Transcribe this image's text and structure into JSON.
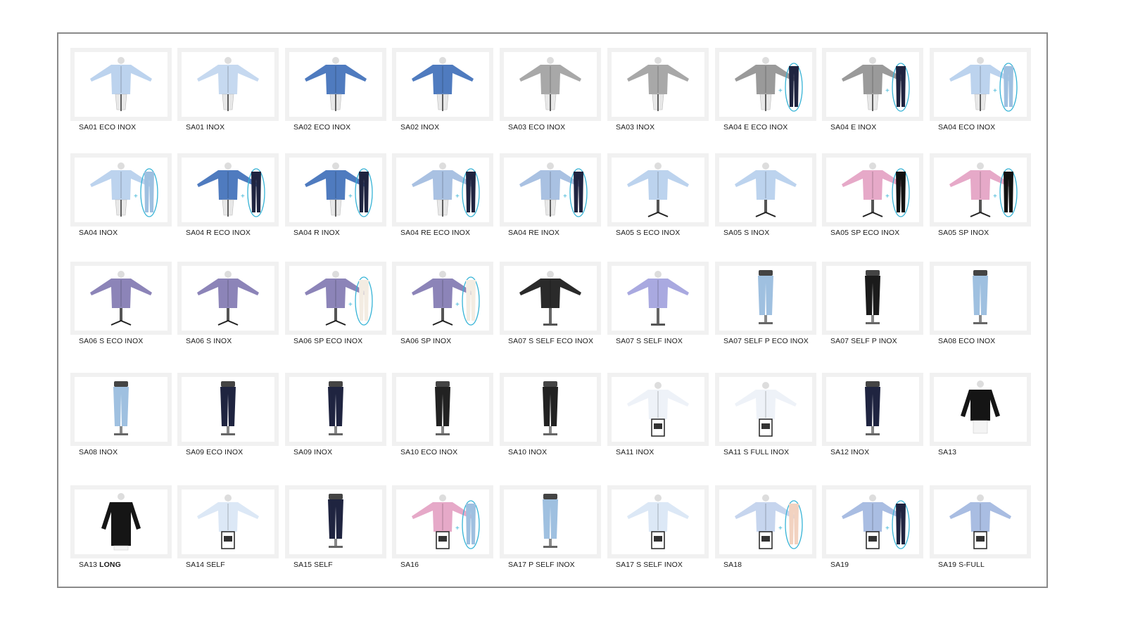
{
  "products": [
    {
      "label": "SA01 ECO INOX",
      "shirt": "#bcd3ee",
      "stand": "dress",
      "extra": null
    },
    {
      "label": "SA01 INOX",
      "shirt": "#c6d9f0",
      "stand": "dress",
      "extra": null
    },
    {
      "label": "SA02 ECO INOX",
      "shirt": "#4f7bbf",
      "stand": "dress",
      "extra": null
    },
    {
      "label": "SA02 INOX",
      "shirt": "#4f7bbf",
      "stand": "dress",
      "extra": null
    },
    {
      "label": "SA03 ECO INOX",
      "shirt": "#a8a8a8",
      "stand": "dress",
      "extra": null
    },
    {
      "label": "SA03 INOX",
      "shirt": "#a8a8a8",
      "stand": "dress",
      "extra": null
    },
    {
      "label": "SA04 E ECO INOX",
      "shirt": "#9a9a9a",
      "stand": "dress",
      "extra": "#1f2440"
    },
    {
      "label": "SA04 E INOX",
      "shirt": "#9a9a9a",
      "stand": "dress",
      "extra": "#1f2440"
    },
    {
      "label": "SA04 ECO INOX",
      "shirt": "#bcd3ee",
      "stand": "dress",
      "extra": "#9fc0e0"
    },
    {
      "label": "SA04 INOX",
      "shirt": "#bcd3ee",
      "stand": "dress",
      "extra": "#9fc0e0"
    },
    {
      "label": "SA04 R ECO INOX",
      "shirt": "#4f7bbf",
      "stand": "dress",
      "extra": "#1f2440"
    },
    {
      "label": "SA04 R INOX",
      "shirt": "#4f7bbf",
      "stand": "dress",
      "extra": "#1f2440"
    },
    {
      "label": "SA04 RE ECO INOX",
      "shirt": "#a9c1e2",
      "stand": "dress",
      "extra": "#1f2440"
    },
    {
      "label": "SA04 RE INOX",
      "shirt": "#a9c1e2",
      "stand": "dress",
      "extra": "#1f2440"
    },
    {
      "label": "SA05 S ECO INOX",
      "shirt": "#bcd3ee",
      "stand": "chair",
      "extra": null
    },
    {
      "label": "SA05 S INOX",
      "shirt": "#bcd3ee",
      "stand": "chair",
      "extra": null
    },
    {
      "label": "SA05 SP ECO INOX",
      "shirt": "#e6a9c8",
      "stand": "chair",
      "extra": "#111111"
    },
    {
      "label": "SA05 SP INOX",
      "shirt": "#e6a9c8",
      "stand": "chair",
      "extra": "#111111"
    },
    {
      "label": "SA06 S ECO INOX",
      "shirt": "#8c84b8",
      "stand": "chair",
      "extra": null
    },
    {
      "label": "SA06 S INOX",
      "shirt": "#8c84b8",
      "stand": "chair",
      "extra": null
    },
    {
      "label": "SA06 SP ECO INOX",
      "shirt": "#8c84b8",
      "stand": "chair",
      "extra": "#f3ece2"
    },
    {
      "label": "SA06 SP INOX",
      "shirt": "#8c84b8",
      "stand": "chair",
      "extra": "#f3ece2"
    },
    {
      "label": "SA07 S SELF ECO INOX",
      "shirt": "#2a2a2a",
      "stand": "pole",
      "extra": null
    },
    {
      "label": "SA07 S SELF INOX",
      "shirt": "#a9a9e0",
      "stand": "pole",
      "extra": null
    },
    {
      "label": "SA07 SELF P ECO INOX",
      "shirt": "#9fc0e0",
      "stand": "trousers",
      "extra": null
    },
    {
      "label": "SA07 SELF  P INOX",
      "shirt": "#1b1b1b",
      "stand": "trousers",
      "extra": null
    },
    {
      "label": "SA08 ECO INOX",
      "shirt": "#9fc0e0",
      "stand": "trousers",
      "extra": null
    },
    {
      "label": "SA08 INOX",
      "shirt": "#9fc0e0",
      "stand": "trousers",
      "extra": null
    },
    {
      "label": "SA09 ECO INOX",
      "shirt": "#1f2440",
      "stand": "trousers",
      "extra": null
    },
    {
      "label": "SA09 INOX",
      "shirt": "#1f2440",
      "stand": "trousers",
      "extra": null
    },
    {
      "label": "SA10 ECO INOX",
      "shirt": "#222222",
      "stand": "trousers",
      "extra": null
    },
    {
      "label": "SA10 INOX",
      "shirt": "#222222",
      "stand": "trousers",
      "extra": null
    },
    {
      "label": "SA11 INOX",
      "shirt": "#eef2f8",
      "stand": "box",
      "extra": null
    },
    {
      "label": "SA11 S FULL INOX",
      "shirt": "#eef2f8",
      "stand": "box",
      "extra": null
    },
    {
      "label": "SA12 INOX",
      "shirt": "#1f2440",
      "stand": "trousers",
      "extra": null
    },
    {
      "label": "SA13",
      "shirt": "#151515",
      "stand": "coat",
      "extra": null
    },
    {
      "label": "SA13",
      "label_bold": "LONG",
      "shirt": "#151515",
      "stand": "long",
      "extra": null
    },
    {
      "label": "SA14 SELF",
      "shirt": "#dce8f6",
      "stand": "box",
      "extra": null
    },
    {
      "label": "SA15 SELF",
      "shirt": "#1f2440",
      "stand": "trousers",
      "extra": null
    },
    {
      "label": "SA16",
      "shirt": "#e6a9c8",
      "stand": "box",
      "extra": "#9fc0e0"
    },
    {
      "label": "SA17 P SELF INOX",
      "shirt": "#9fc0e0",
      "stand": "trousers",
      "extra": null
    },
    {
      "label": "SA17 S SELF INOX",
      "shirt": "#dce8f6",
      "stand": "box",
      "extra": null
    },
    {
      "label": "SA18",
      "shirt": "#c6d5ee",
      "stand": "box",
      "extra": "#f2d2c0"
    },
    {
      "label": "SA19",
      "shirt": "#a9bde2",
      "stand": "box",
      "extra": "#1f2440"
    },
    {
      "label": "SA19 S-FULL",
      "shirt": "#a9bde2",
      "stand": "box",
      "extra": null
    }
  ],
  "colors": {
    "accent": "#35b3d6",
    "frame": "#8a8a8a"
  }
}
